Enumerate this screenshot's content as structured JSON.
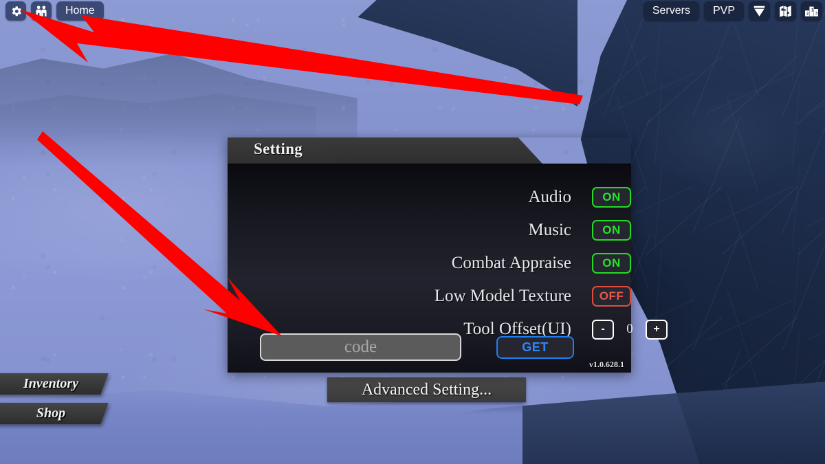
{
  "topbar": {
    "left_items": [
      {
        "name": "settings-gear",
        "label": "",
        "icon": "gear-icon"
      },
      {
        "name": "friends",
        "label": "",
        "icon": "people-icon"
      },
      {
        "name": "home",
        "label": "Home",
        "icon": ""
      }
    ],
    "right_items": [
      {
        "name": "servers",
        "label": "Servers",
        "icon": ""
      },
      {
        "name": "pvp",
        "label": "PVP",
        "icon": ""
      },
      {
        "name": "badge",
        "label": "",
        "icon": "badge-icon"
      },
      {
        "name": "map",
        "label": "",
        "icon": "map-icon"
      },
      {
        "name": "leaderboard",
        "label": "",
        "icon": "podium-icon"
      }
    ]
  },
  "setting_panel": {
    "title": "Setting",
    "close_label": "✕",
    "version": "v1.0.628.1",
    "rows": [
      {
        "label": "Audio",
        "value": "ON",
        "state": "on"
      },
      {
        "label": "Music",
        "value": "ON",
        "state": "on"
      },
      {
        "label": "Combat Appraise",
        "value": "ON",
        "state": "on"
      },
      {
        "label": "Low Model Texture",
        "value": "OFF",
        "state": "off"
      }
    ],
    "tool_offset": {
      "label": "Tool Offset(UI)",
      "decrement_label": "-",
      "increment_label": "+",
      "value": "0"
    },
    "code": {
      "placeholder": "code",
      "value": "",
      "submit_label": "GET"
    }
  },
  "advanced_button": {
    "label": "Advanced Setting..."
  },
  "side_menu": {
    "items": [
      {
        "label": "Inventory"
      },
      {
        "label": "Shop"
      }
    ]
  },
  "colors": {
    "toggle_on": "#2ae02a",
    "toggle_off": "#e8574a",
    "get_accent": "#2e86ff",
    "close_bg": "#b33b22",
    "annotation": "#ff0000",
    "snow": "#8593cf",
    "rock": "#1e2e4d"
  },
  "annotations": {
    "arrow_1_target": "settings-gear",
    "arrow_2_target": "code-input"
  }
}
